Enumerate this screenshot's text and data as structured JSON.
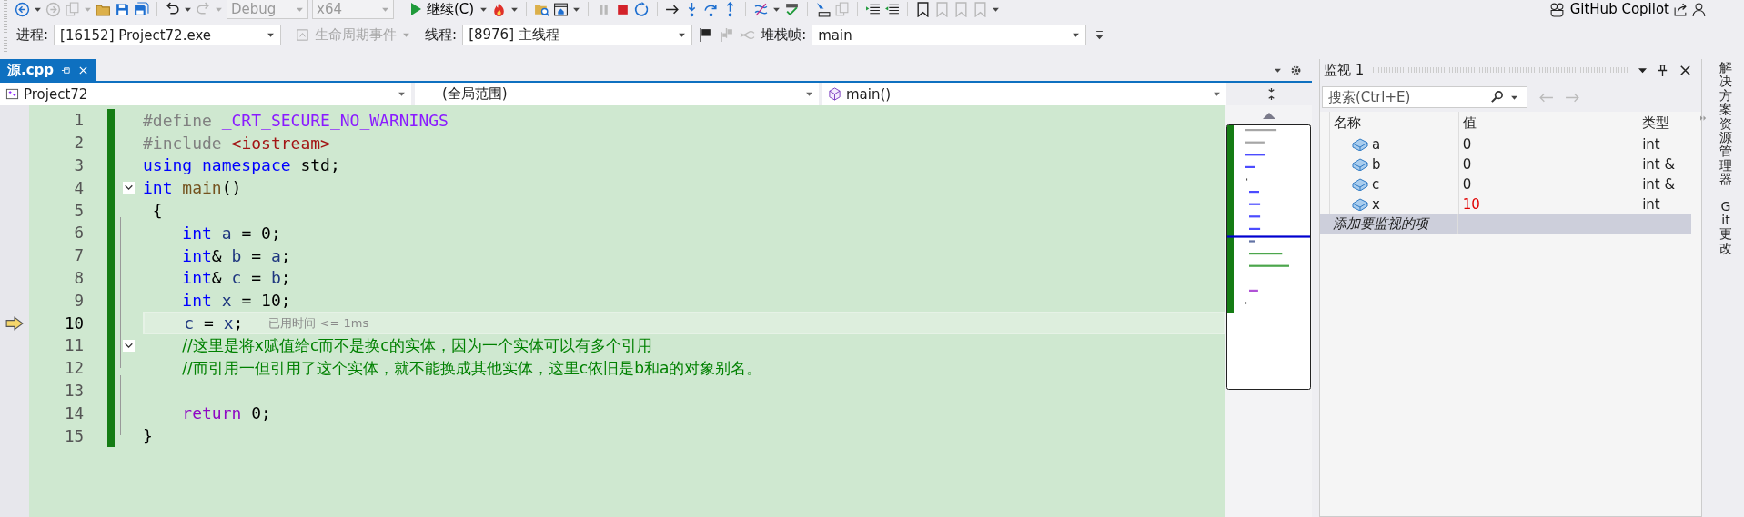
{
  "toolbar": {
    "configuration": {
      "value": "Debug",
      "disabled": true
    },
    "platform": {
      "value": "x64",
      "disabled": true
    },
    "continue_button": "继续(C)",
    "copilot_button": "GitHub Copilot"
  },
  "debug_location": {
    "process_label": "进程:",
    "process": "[16152] Project72.exe",
    "lifecycle_button": {
      "label": "生命周期事件",
      "disabled": true
    },
    "thread_label": "线程:",
    "thread": "[8976] 主线程",
    "stack_frame_label": "堆栈帧:",
    "stack_frame": "main"
  },
  "tabs": [
    {
      "label": "源.cpp",
      "selected": true
    }
  ],
  "navigation": {
    "project": "Project72",
    "scope": "(全局范围)",
    "member": "main()"
  },
  "code": [
    {
      "number": "1",
      "tokens": [
        {
          "kind": "preproc",
          "text": "#define"
        },
        {
          "kind": "macro",
          "text": " _CRT_SECURE_NO_WARNINGS"
        }
      ]
    },
    {
      "number": "2",
      "tokens": [
        {
          "kind": "preproc",
          "text": "#include"
        },
        {
          "kind": "string",
          "text": " <iostream>"
        }
      ]
    },
    {
      "number": "3",
      "tokens": [
        {
          "kind": "keyword",
          "text": "using"
        },
        {
          "kind": "keyword",
          "text": " namespace"
        },
        {
          "kind": "plain",
          "text": " std;"
        }
      ]
    },
    {
      "number": "4",
      "fold": {
        "expanded": true
      },
      "tokens": [
        {
          "kind": "keyword",
          "text": "int"
        },
        {
          "kind": "function",
          "text": " main"
        },
        {
          "kind": "plain",
          "text": "()"
        }
      ]
    },
    {
      "number": "5",
      "tokens": [
        {
          "kind": "plain",
          "text": " {"
        }
      ]
    },
    {
      "number": "6",
      "tokens": [
        {
          "kind": "keyword",
          "text": "    int"
        },
        {
          "kind": "variable",
          "text": " a"
        },
        {
          "kind": "plain",
          "text": " = 0;"
        }
      ]
    },
    {
      "number": "7",
      "tokens": [
        {
          "kind": "keyword",
          "text": "    int"
        },
        {
          "kind": "plain",
          "text": "&"
        },
        {
          "kind": "variable",
          "text": " b"
        },
        {
          "kind": "plain",
          "text": " ="
        },
        {
          "kind": "variable",
          "text": " a"
        },
        {
          "kind": "plain",
          "text": ";"
        }
      ]
    },
    {
      "number": "8",
      "tokens": [
        {
          "kind": "keyword",
          "text": "    int"
        },
        {
          "kind": "plain",
          "text": "&"
        },
        {
          "kind": "variable",
          "text": " c"
        },
        {
          "kind": "plain",
          "text": " ="
        },
        {
          "kind": "variable",
          "text": " b"
        },
        {
          "kind": "plain",
          "text": ";"
        }
      ]
    },
    {
      "number": "9",
      "tokens": [
        {
          "kind": "keyword",
          "text": "    int"
        },
        {
          "kind": "variable",
          "text": " x"
        },
        {
          "kind": "plain",
          "text": " = 10;"
        }
      ]
    },
    {
      "number": "10",
      "current": true,
      "tokens": [
        {
          "kind": "variable",
          "text": "    c"
        },
        {
          "kind": "plain",
          "text": " ="
        },
        {
          "kind": "variable",
          "text": " x"
        },
        {
          "kind": "plain",
          "text": ";"
        }
      ],
      "perf_tip": "已用时间 <= 1ms"
    },
    {
      "number": "11",
      "fold": {
        "expanded": true
      },
      "tokens": [
        {
          "kind": "comment",
          "text": "    //这里是将x赋值给c而不是换c的实体，因为一个实体可以有多个引用"
        }
      ]
    },
    {
      "number": "12",
      "tokens": [
        {
          "kind": "comment",
          "text": "    //而引用一但引用了这个实体，就不能换成其他实体，这里c依旧是b和a的对象别名。"
        }
      ]
    },
    {
      "number": "13"
    },
    {
      "number": "14",
      "tokens": [
        {
          "kind": "control",
          "text": "    return"
        },
        {
          "kind": "plain",
          "text": " 0;"
        }
      ]
    },
    {
      "number": "15",
      "tokens": [
        {
          "kind": "plain",
          "text": "}"
        }
      ]
    }
  ],
  "watch": {
    "title": "监视 1",
    "search": {
      "placeholder": "搜索(Ctrl+E)"
    },
    "columns": [
      "名称",
      "值",
      "类型"
    ],
    "rows": [
      {
        "name": "a",
        "value": "0",
        "type": "int",
        "changed": false
      },
      {
        "name": "b",
        "value": "0",
        "type": "int &",
        "changed": false
      },
      {
        "name": "c",
        "value": "0",
        "type": "int &",
        "changed": false
      },
      {
        "name": "x",
        "value": "10",
        "type": "int",
        "changed": true
      }
    ],
    "add_item": "添加要监视的项"
  },
  "side_tabs": [
    "解决方案资源管理器",
    "Git 更改"
  ]
}
